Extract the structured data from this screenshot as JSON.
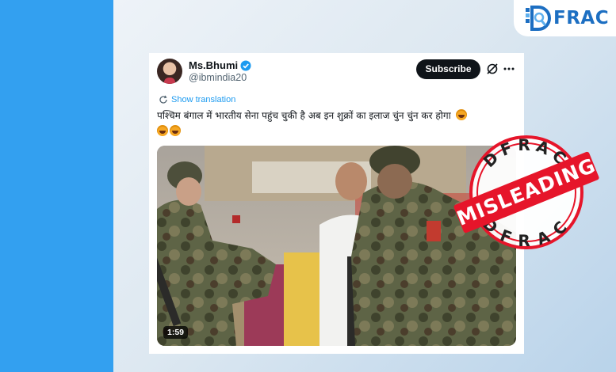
{
  "brand": {
    "name": "FRAC",
    "mark_letter": "D"
  },
  "tweet": {
    "author_name": "Ms.Bhumi",
    "handle": "@ibmindia20",
    "subscribe_label": "Subscribe",
    "show_translation_label": "Show translation",
    "text": "पश्चिम बंगाल में भारतीय सेना पहुंच चुकी है अब इन शुक्रों का इलाज चुंन चुंन कर होगा",
    "video_duration": "1:59"
  },
  "stamp": {
    "label": "MISLEADING",
    "top_text": "DFRAC",
    "bottom_text": "DFRAC",
    "color": "#e6152a"
  },
  "colors": {
    "accent_blue": "#1d9bf0",
    "brand_blue": "#1d6fc2",
    "background_blue": "#33a0f0"
  }
}
